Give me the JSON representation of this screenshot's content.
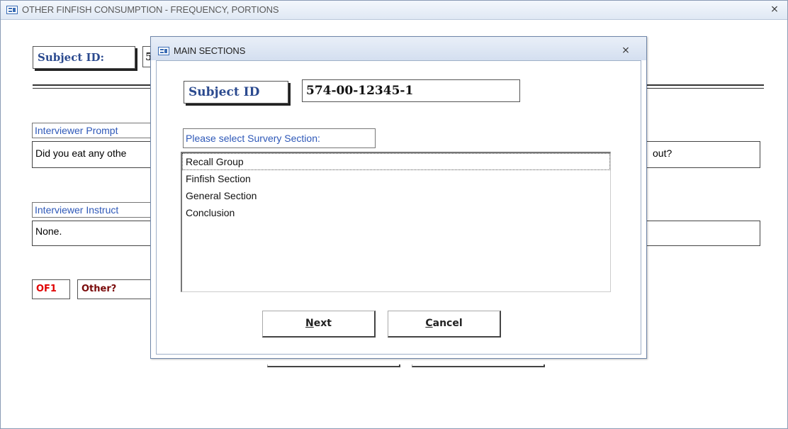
{
  "background_window": {
    "title": "OTHER FINFISH CONSUMPTION - FREQUENCY, PORTIONS",
    "subject_id_label": "Subject ID:",
    "subject_id_value_partial": "5",
    "interviewer_prompt_label": "Interviewer Prompt",
    "prompt_text_left": "Did you eat any othe",
    "prompt_text_right": "out?",
    "interviewer_instructions_label": "Interviewer Instruct",
    "instructions_text": "None.",
    "question_code": "OF1",
    "question_label": "Other?"
  },
  "dialog": {
    "title": "MAIN SECTIONS",
    "subject_id_label": "Subject ID",
    "subject_id_value": "574-00-12345-1",
    "prompt": "Please select Survery Section:",
    "sections": [
      "Recall Group",
      "Finfish Section",
      "General Section",
      "Conclusion"
    ],
    "selected_index": 0,
    "next_button": {
      "accel": "N",
      "rest": "ext"
    },
    "cancel_button": {
      "accel": "C",
      "rest": "ancel"
    }
  },
  "colors": {
    "label_blue": "#2e58b8",
    "label_bold_blue": "#2b4a8f",
    "code_red": "#e00000",
    "label_maroon": "#7a0a0a"
  },
  "icons": {
    "window": "form-icon",
    "close": "close-icon"
  }
}
